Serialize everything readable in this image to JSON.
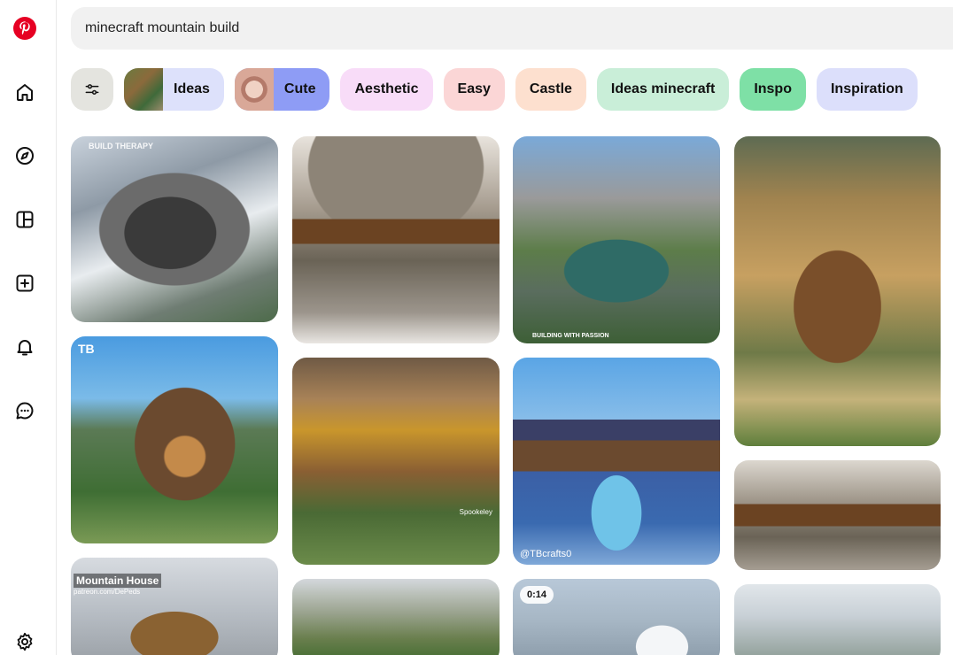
{
  "search": {
    "query": "minecraft mountain build"
  },
  "chips": [
    {
      "label": "Ideas",
      "bg": "#dde1fb"
    },
    {
      "label": "Cute",
      "bg": "#8e9cf5"
    },
    {
      "label": "Aesthetic",
      "bg": "#f8dcf8"
    },
    {
      "label": "Easy",
      "bg": "#fbd6d6"
    },
    {
      "label": "Castle",
      "bg": "#fde0cf"
    },
    {
      "label": "Ideas minecraft",
      "bg": "#c9eed8"
    },
    {
      "label": "Inspo",
      "bg": "#7ee0a6"
    },
    {
      "label": "Inspiration",
      "bg": "#dcdffb"
    }
  ],
  "pins": {
    "p1": {
      "watermark": "BUILD THERAPY"
    },
    "p2": {
      "watermark": "TB"
    },
    "p3": {
      "title": "Mountain House",
      "sub": "patreon.com/DePeds"
    },
    "p6": {
      "credit": "Spookeley"
    },
    "p8": {
      "title": "BUILDING WITH PASSION"
    },
    "p9": {
      "credit": "@TBcrafts0"
    },
    "p10": {
      "duration": "0:14"
    }
  },
  "colors": {
    "brand": "#e60023"
  }
}
